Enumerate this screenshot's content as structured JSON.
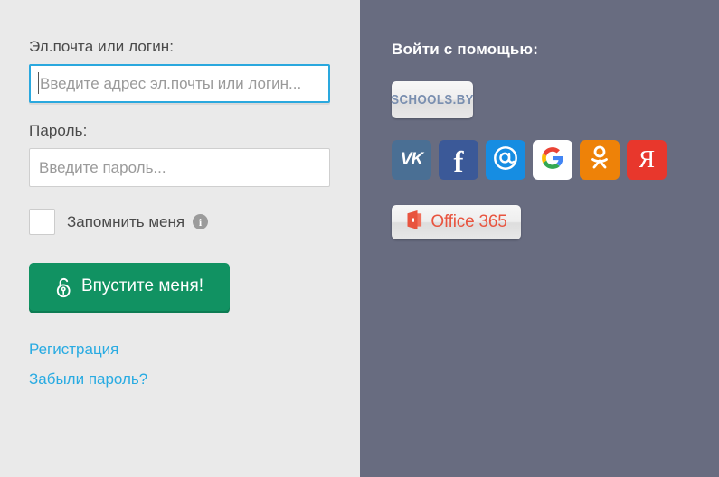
{
  "login_form": {
    "email_label": "Эл.почта или логин:",
    "email_placeholder": "Введите адрес эл.почты или логин...",
    "email_value": "",
    "password_label": "Пароль:",
    "password_placeholder": "Введите пароль...",
    "password_value": "",
    "remember_label": "Запомнить меня",
    "remember_checked": false,
    "info_icon": "info-icon",
    "info_glyph": "i",
    "submit_label": "Впустите меня!",
    "submit_icon": "open-padlock-icon",
    "links": [
      {
        "label": "Регистрация"
      },
      {
        "label": "Забыли пароль?"
      }
    ]
  },
  "social_panel": {
    "title": "Войти с помощью:",
    "schools_badge": {
      "label": "SCHOOLS.BY",
      "icon": "schools-by-logo"
    },
    "providers": [
      {
        "name": "vk",
        "label": "VK",
        "glyph": "VK",
        "color": "#4a6f94",
        "icon": "vk-icon"
      },
      {
        "name": "facebook",
        "label": "Facebook",
        "glyph": "f",
        "color": "#3b5998",
        "icon": "facebook-icon"
      },
      {
        "name": "mailru",
        "label": "Mail.ru",
        "glyph": "@",
        "color": "#168de2",
        "icon": "mailru-icon"
      },
      {
        "name": "google",
        "label": "Google",
        "glyph": "G",
        "color": "#ffffff",
        "icon": "google-icon"
      },
      {
        "name": "odnoklassniki",
        "label": "Одноклассники",
        "glyph": "ok",
        "color": "#ee8208",
        "icon": "odnoklassniki-icon"
      },
      {
        "name": "yandex",
        "label": "Яндекс",
        "glyph": "Я",
        "color": "#e8372c",
        "icon": "yandex-icon"
      }
    ],
    "office_badge": {
      "label": "Office 365",
      "icon": "office-365-logo"
    }
  },
  "colors": {
    "left_background": "#eaeaea",
    "right_background": "#686c80",
    "accent_link": "#29abe2",
    "focus_border": "#2aa8de",
    "submit_green": "#119262"
  }
}
